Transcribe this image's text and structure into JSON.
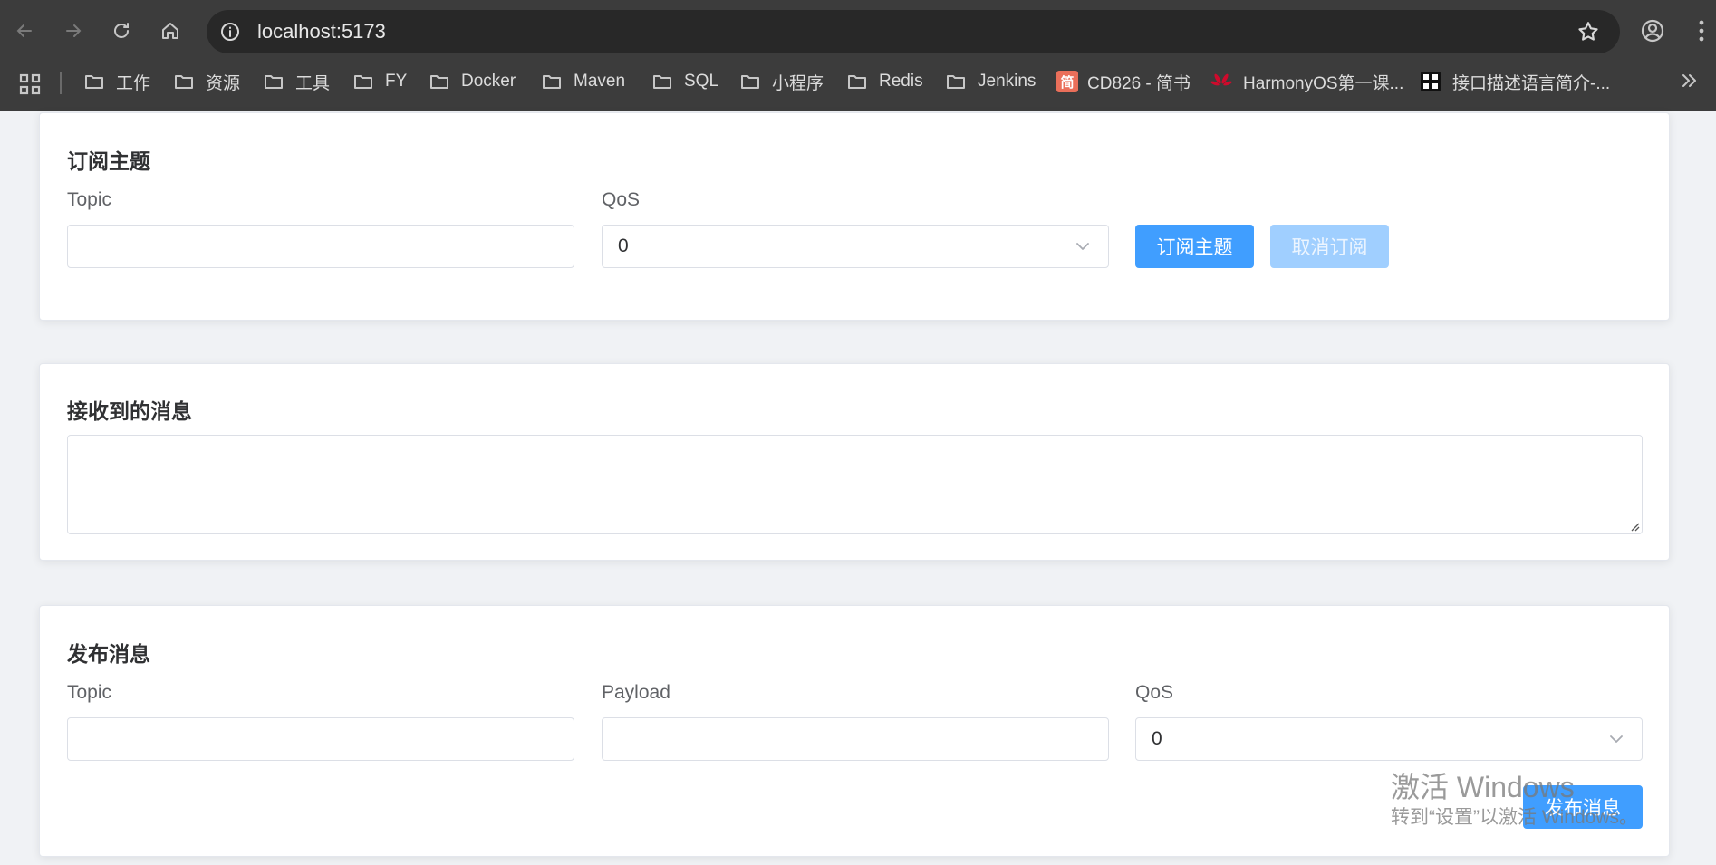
{
  "browser": {
    "url": "localhost:5173",
    "bookmarks": [
      {
        "label": "工作",
        "type": "folder"
      },
      {
        "label": "资源",
        "type": "folder"
      },
      {
        "label": "工具",
        "type": "folder"
      },
      {
        "label": "FY",
        "type": "folder"
      },
      {
        "label": "Docker",
        "type": "folder"
      },
      {
        "label": "Maven",
        "type": "folder"
      },
      {
        "label": "SQL",
        "type": "folder"
      },
      {
        "label": "小程序",
        "type": "folder"
      },
      {
        "label": "Redis",
        "type": "folder"
      },
      {
        "label": "Jenkins",
        "type": "folder"
      },
      {
        "label": "CD826 - 简书",
        "type": "site",
        "icon_text": "简",
        "icon_color": "#ea6f5a"
      },
      {
        "label": "HarmonyOS第一课...",
        "type": "site",
        "icon": "huawei-logo-icon"
      },
      {
        "label": "接口描述语言简介-...",
        "type": "site",
        "icon": "hmos-logo-icon"
      }
    ]
  },
  "subscribe": {
    "title": "订阅主题",
    "topic_label": "Topic",
    "topic_value": "",
    "qos_label": "QoS",
    "qos_value": "0",
    "subscribe_button": "订阅主题",
    "unsubscribe_button": "取消订阅"
  },
  "received": {
    "title": "接收到的消息",
    "messages_value": ""
  },
  "publish": {
    "title": "发布消息",
    "topic_label": "Topic",
    "topic_value": "",
    "payload_label": "Payload",
    "payload_value": "",
    "qos_label": "QoS",
    "qos_value": "0",
    "publish_button": "发布消息"
  },
  "watermark": {
    "line1": "激活 Windows",
    "line2": "转到“设置”以激活 Windows。"
  },
  "colors": {
    "primary": "#409eff",
    "primary_disabled": "#a0cfff",
    "chrome_bg": "#3c3c3c"
  }
}
